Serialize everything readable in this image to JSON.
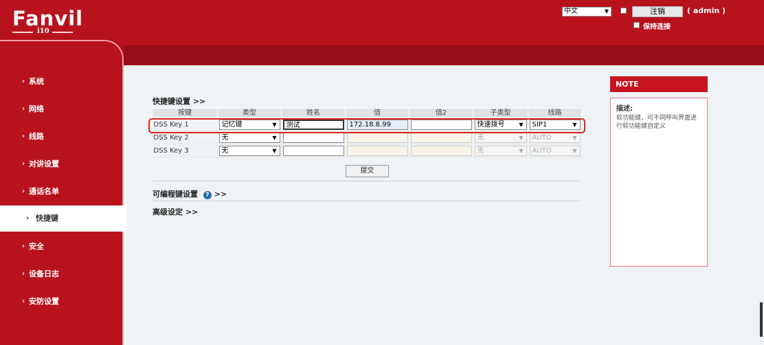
{
  "header": {
    "logo_text": "Fanvil",
    "model": "i10",
    "language": "中文",
    "logout_label": "注销",
    "user": "( admin )",
    "keep_connected_label": "保持连接"
  },
  "sidebar": {
    "items": [
      {
        "label": "系统"
      },
      {
        "label": "网络"
      },
      {
        "label": "线路"
      },
      {
        "label": "对讲设置"
      },
      {
        "label": "通话名单"
      },
      {
        "label": "快捷键"
      },
      {
        "label": "安全"
      },
      {
        "label": "设备日志"
      },
      {
        "label": "安防设置"
      }
    ],
    "active_index": 5
  },
  "main": {
    "section_title": "快捷键设置 >>",
    "columns": [
      "按键",
      "类型",
      "姓名",
      "值",
      "值2",
      "子类型",
      "线路"
    ],
    "rows": [
      {
        "key": "DSS Key 1",
        "type": "记忆键",
        "name": "测试",
        "value": "172.18.8.99",
        "value2": "",
        "subtype": "快速拨号",
        "line": "SIP1"
      },
      {
        "key": "DSS Key 2",
        "type": "无",
        "name": "",
        "value": "",
        "value2": "",
        "subtype": "无",
        "line": "AUTO"
      },
      {
        "key": "DSS Key 3",
        "type": "无",
        "name": "",
        "value": "",
        "value2": "",
        "subtype": "无",
        "line": "AUTO"
      }
    ],
    "submit_label": "提交",
    "programmable_title": "可编程键设置",
    "programmable_suffix": ">>",
    "advanced_title": "高级设定 >>"
  },
  "note": {
    "title": "NOTE",
    "desc_title": "描述:",
    "desc_text": "软功能键，可不同呼叫界面进行软功能键自定义"
  },
  "colors": {
    "brand_red": "#b8121d",
    "highlight": "#e0211d"
  }
}
